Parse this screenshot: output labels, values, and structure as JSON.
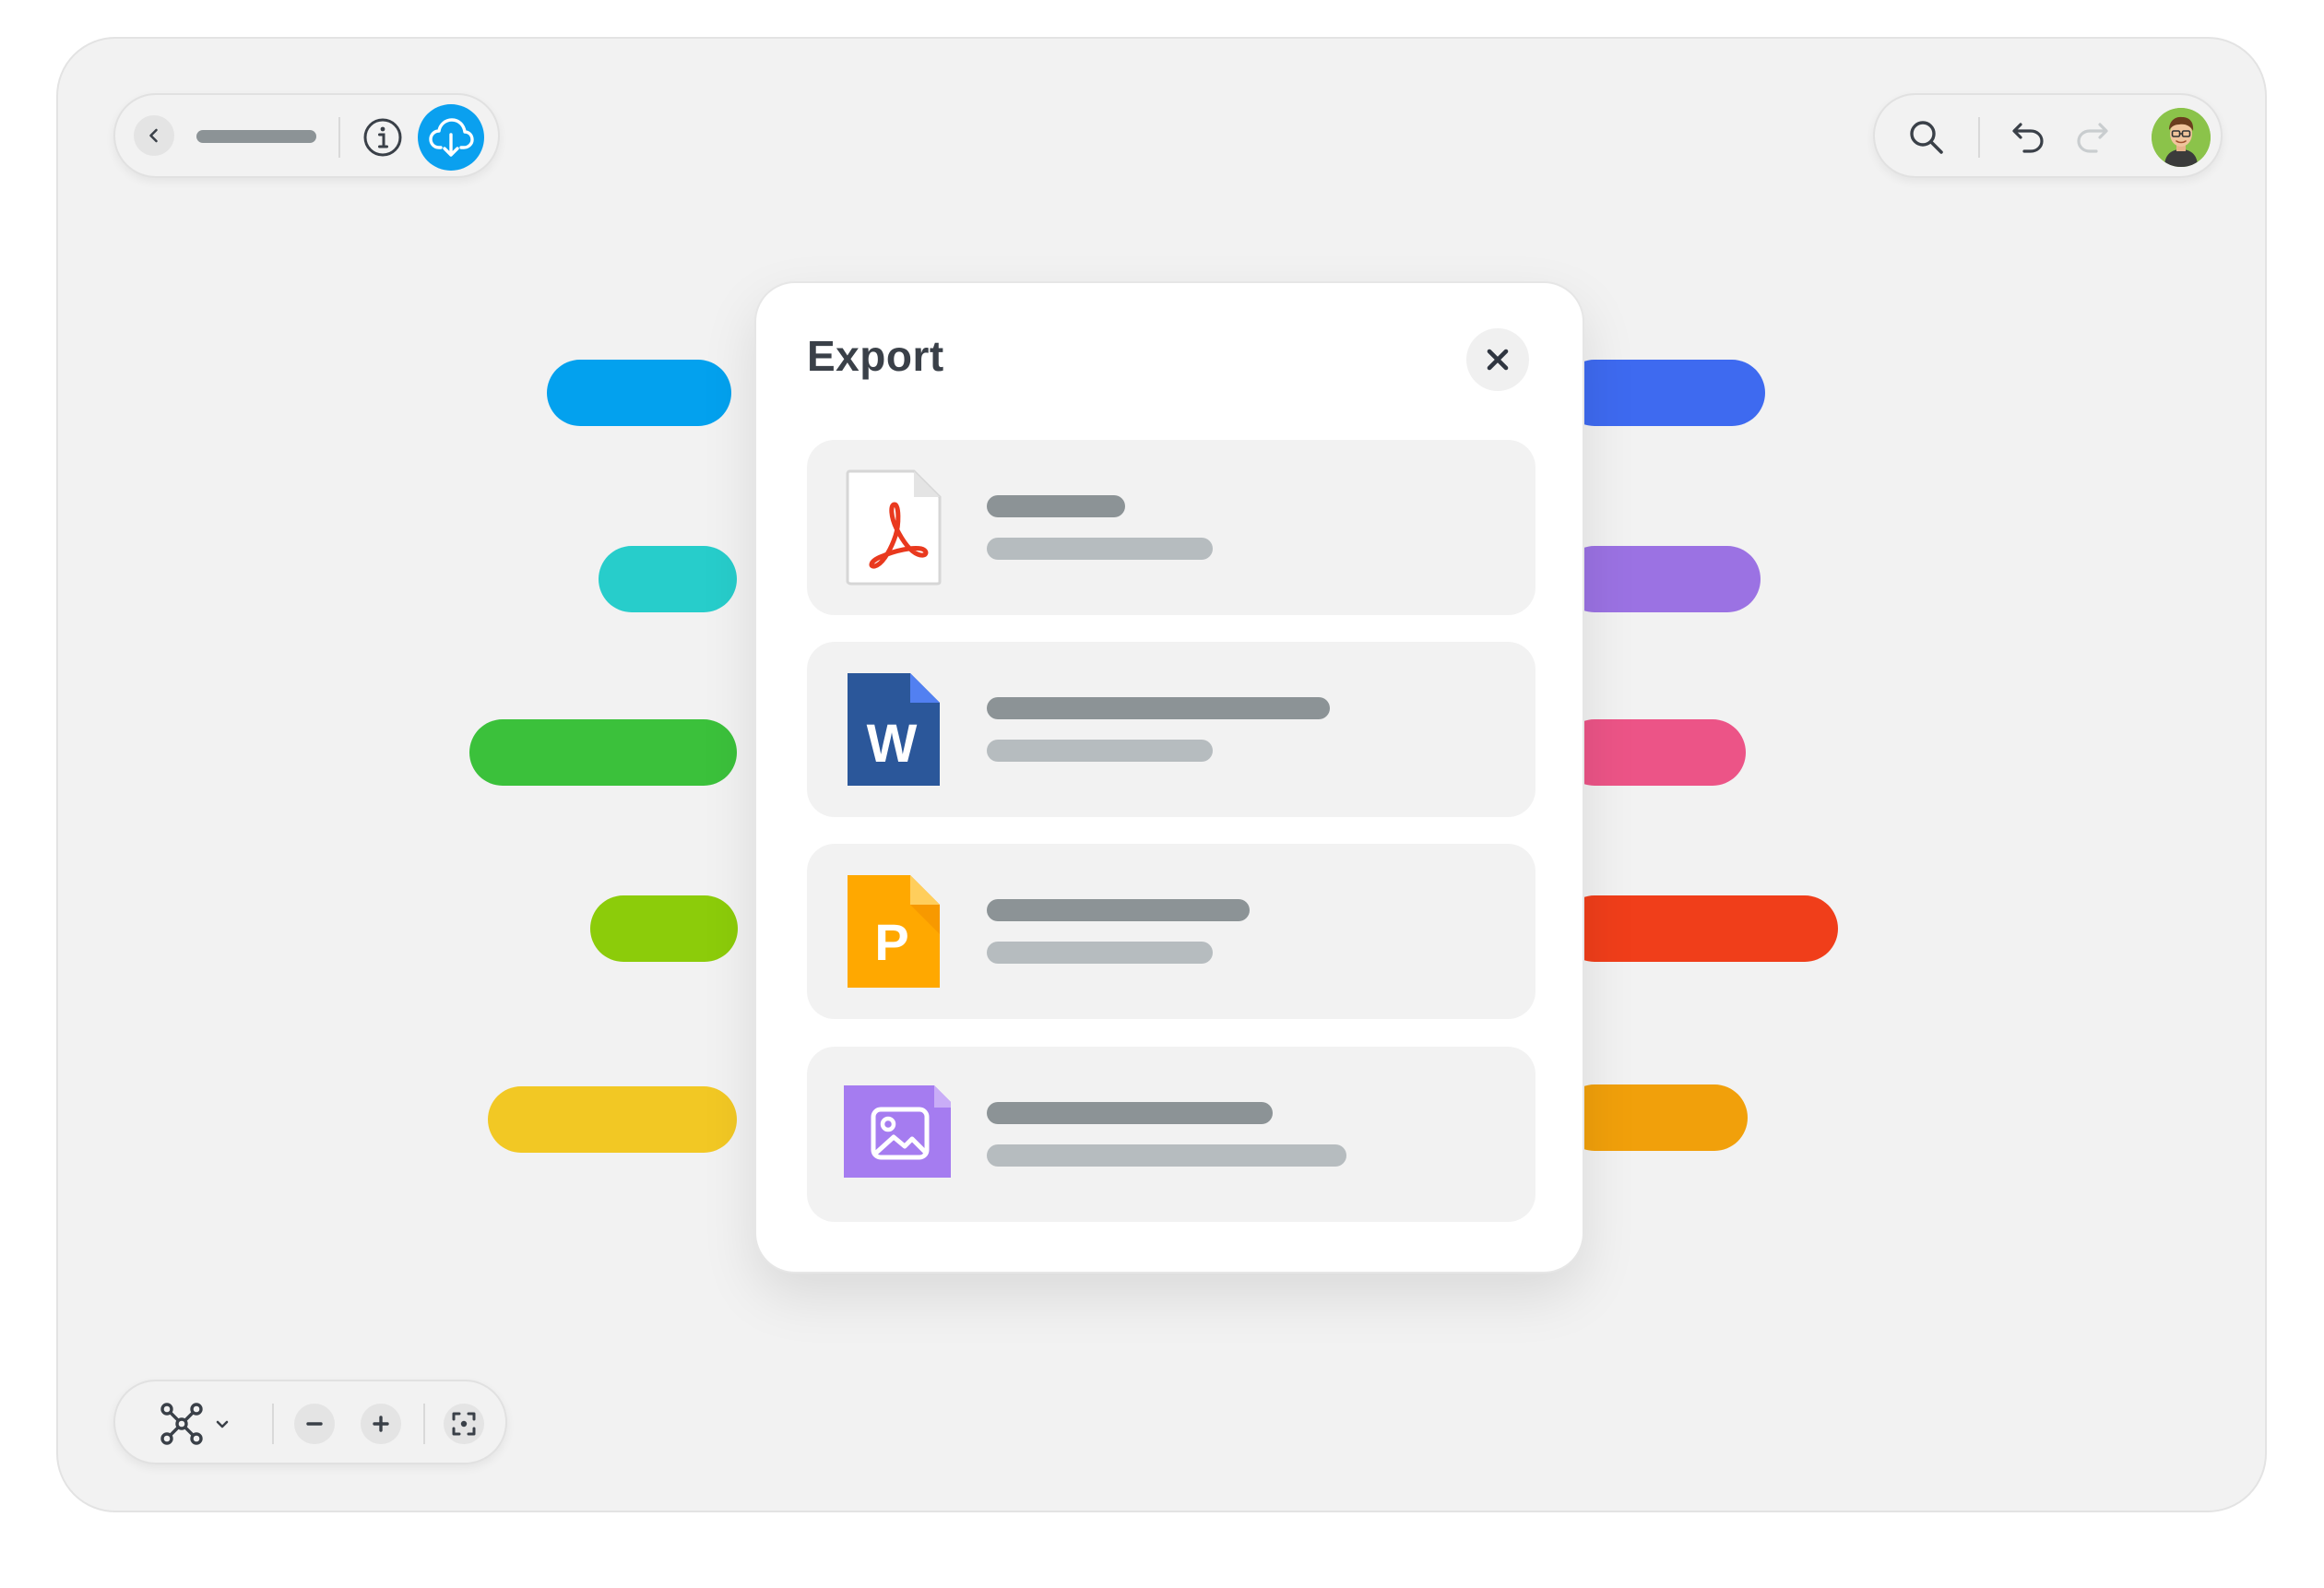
{
  "toolbar_top_left": {
    "back_icon": "chevron-left-icon",
    "info_icon": "info-icon",
    "export_icon": "cloud-download-icon",
    "export_accent": "#0aa0ef"
  },
  "toolbar_top_right": {
    "search_icon": "search-icon",
    "undo_icon": "undo-icon",
    "redo_icon": "redo-icon",
    "avatar_icon": "user-avatar"
  },
  "toolbar_bottom": {
    "layout_icon": "mindmap-layout-icon",
    "zoom_out_symbol": "−",
    "zoom_in_symbol": "+",
    "fit_icon": "fit-screen-icon"
  },
  "canvas": {
    "left_nodes": [
      {
        "color": "#03a1ee"
      },
      {
        "color": "#27cdcb"
      },
      {
        "color": "#3bc13b"
      },
      {
        "color": "#8ccc0a"
      },
      {
        "color": "#f2c824"
      }
    ],
    "right_nodes": [
      {
        "color": "#3e6af0"
      },
      {
        "color": "#9b72e3"
      },
      {
        "color": "#ec5487"
      },
      {
        "color": "#f03e1a"
      },
      {
        "color": "#f1a00b"
      }
    ]
  },
  "export_dialog": {
    "title": "Export",
    "close_icon": "close-icon",
    "options": [
      {
        "format": "pdf",
        "icon": "pdf-file-icon",
        "color": "#e9391e"
      },
      {
        "format": "word",
        "icon": "word-file-icon",
        "color": "#2b579a",
        "letter": "W"
      },
      {
        "format": "powerpoint",
        "icon": "powerpoint-file-icon",
        "color": "#ffa800",
        "letter": "P"
      },
      {
        "format": "image",
        "icon": "image-file-icon",
        "color": "#a57cf0"
      }
    ]
  }
}
